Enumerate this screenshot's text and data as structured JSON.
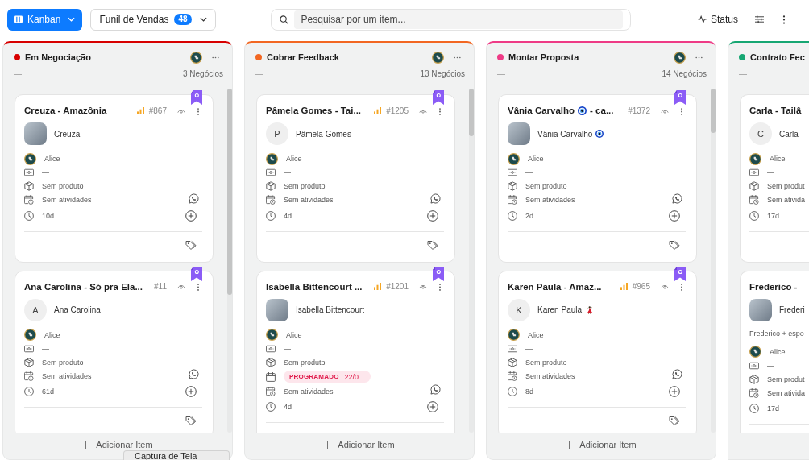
{
  "toolbar": {
    "view_button": "Kanban",
    "pipeline": {
      "label": "Funil de Vendas",
      "count": "48"
    },
    "search": {
      "placeholder": "Pesquisar por um item..."
    },
    "status_button": "Status"
  },
  "columns": [
    {
      "title": "Em Negociação",
      "color": "#d70000",
      "value": "—",
      "count": "3 Negócios",
      "clipped": false,
      "add_label": "Adicionar Item",
      "cards": [
        {
          "title": "Creuza - Amazônia",
          "priority": true,
          "number": "#867",
          "bookmarked": true,
          "contact": {
            "kind": "photo",
            "name": "Creuza"
          },
          "rows": [
            {
              "kind": "owner",
              "text": "Alice"
            },
            {
              "kind": "value",
              "text": "—"
            },
            {
              "kind": "product",
              "text": "Sem produto"
            },
            {
              "kind": "activities",
              "text": "Sem atividades"
            },
            {
              "kind": "age",
              "text": "10d"
            }
          ],
          "tag_button": true
        },
        {
          "title": "Ana Carolina - Só pra Ela...",
          "priority": false,
          "number": "#11",
          "bookmarked": true,
          "contact": {
            "kind": "initial",
            "initial": "A",
            "name": "Ana Carolina"
          },
          "rows": [
            {
              "kind": "owner",
              "text": "Alice"
            },
            {
              "kind": "value",
              "text": "—"
            },
            {
              "kind": "product",
              "text": "Sem produto"
            },
            {
              "kind": "activities",
              "text": "Sem atividades"
            },
            {
              "kind": "age",
              "text": "61d"
            }
          ],
          "tag_button": true
        }
      ]
    },
    {
      "title": "Cobrar Feedback",
      "color": "#f26722",
      "value": "—",
      "count": "13 Negócios",
      "clipped": false,
      "add_label": "Adicionar Item",
      "cards": [
        {
          "title": "Pâmela Gomes - Tai...",
          "priority": true,
          "number": "#1205",
          "bookmarked": true,
          "contact": {
            "kind": "initial",
            "initial": "P",
            "name": "Pâmela Gomes"
          },
          "rows": [
            {
              "kind": "owner",
              "text": "Alice"
            },
            {
              "kind": "value",
              "text": "—"
            },
            {
              "kind": "product",
              "text": "Sem produto"
            },
            {
              "kind": "activities",
              "text": "Sem atividades"
            },
            {
              "kind": "age",
              "text": "4d"
            }
          ],
          "tag_button": true
        },
        {
          "title": "Isabella Bittencourt ...",
          "priority": true,
          "number": "#1201",
          "bookmarked": true,
          "contact": {
            "kind": "photo",
            "name": "Isabella Bittencourt"
          },
          "rows": [
            {
              "kind": "owner",
              "text": "Alice"
            },
            {
              "kind": "value",
              "text": "—"
            },
            {
              "kind": "product",
              "text": "Sem produto"
            },
            {
              "kind": "schedule",
              "label": "PROGRAMADO",
              "text": "22/0..."
            },
            {
              "kind": "activities",
              "text": "Sem atividades"
            },
            {
              "kind": "age",
              "text": "4d"
            }
          ],
          "tag_button": false
        }
      ]
    },
    {
      "title": "Montar Proposta",
      "color": "#ee3b86",
      "value": "—",
      "count": "14 Negócios",
      "clipped": false,
      "add_label": "Adicionar Item",
      "cards": [
        {
          "title": "Vânia Carvalho",
          "title_emoji": {
            "kind": "evil-eye"
          },
          "title_end": "- ca...",
          "priority": false,
          "number": "#1372",
          "bookmarked": true,
          "contact": {
            "kind": "photo",
            "name": "Vânia Carvalho",
            "emoji": {
              "kind": "evil-eye"
            }
          },
          "rows": [
            {
              "kind": "owner",
              "text": "Alice"
            },
            {
              "kind": "value",
              "text": "—"
            },
            {
              "kind": "product",
              "text": "Sem produto"
            },
            {
              "kind": "activities",
              "text": "Sem atividades"
            },
            {
              "kind": "age",
              "text": "2d"
            }
          ],
          "tag_button": true
        },
        {
          "title": "Karen Paula - Amaz...",
          "priority": true,
          "number": "#965",
          "bookmarked": true,
          "contact": {
            "kind": "initial",
            "initial": "K",
            "name": "Karen Paula",
            "emoji": {
              "kind": "dancer"
            }
          },
          "rows": [
            {
              "kind": "owner",
              "text": "Alice"
            },
            {
              "kind": "value",
              "text": "—"
            },
            {
              "kind": "product",
              "text": "Sem produto"
            },
            {
              "kind": "activities",
              "text": "Sem atividades"
            },
            {
              "kind": "age",
              "text": "8d"
            }
          ],
          "tag_button": true
        }
      ]
    },
    {
      "title": "Contrato Fec",
      "color": "#16a672",
      "value": "—",
      "clipped": true,
      "cards": [
        {
          "title": "Carla - Tailâ",
          "contact": {
            "kind": "initial",
            "initial": "C",
            "name": "Carla"
          },
          "rows": [
            {
              "kind": "owner",
              "text": "Alice"
            },
            {
              "kind": "value",
              "text": "—"
            },
            {
              "kind": "product",
              "text": "Sem produt"
            },
            {
              "kind": "activities",
              "text": "Sem ativida"
            },
            {
              "kind": "age",
              "text": "17d"
            }
          ]
        },
        {
          "title": "Frederico -",
          "contact": {
            "kind": "photo",
            "name": "Frederi"
          },
          "description": "Frederico + espo",
          "rows": [
            {
              "kind": "owner",
              "text": "Alice"
            },
            {
              "kind": "value",
              "text": "—"
            },
            {
              "kind": "product",
              "text": "Sem produt"
            },
            {
              "kind": "activities",
              "text": "Sem ativida"
            },
            {
              "kind": "age",
              "text": "17d"
            }
          ]
        }
      ]
    }
  ],
  "tooltip": "Captura de Tela"
}
